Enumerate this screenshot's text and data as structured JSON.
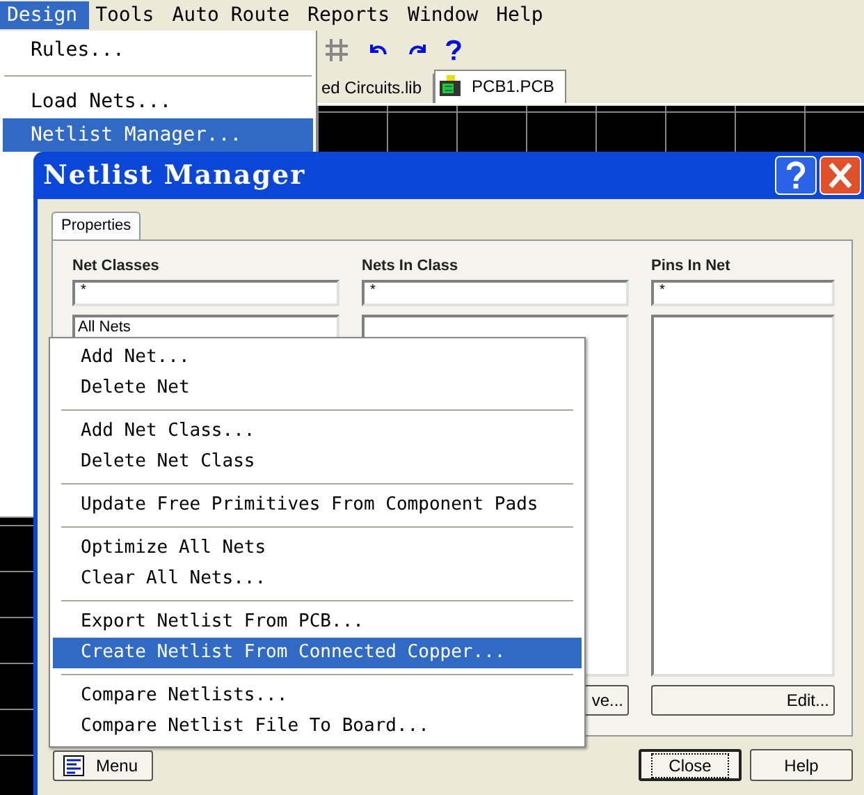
{
  "menubar": [
    {
      "label": "Design",
      "selected": true
    },
    {
      "label": "Tools",
      "selected": false
    },
    {
      "label": "Auto Route",
      "selected": false
    },
    {
      "label": "Reports",
      "selected": false
    },
    {
      "label": "Window",
      "selected": false
    },
    {
      "label": "Help",
      "selected": false
    }
  ],
  "design_menu": {
    "groups": [
      [
        {
          "label": "Rules...",
          "selected": false
        }
      ],
      [
        {
          "label": "Load Nets...",
          "selected": false
        },
        {
          "label": "Netlist Manager...",
          "selected": true
        }
      ]
    ]
  },
  "document_tabs": [
    {
      "label": "ed Circuits.lib",
      "selected": false
    },
    {
      "label": "PCB1.PCB",
      "selected": true
    }
  ],
  "dialog": {
    "title": "Netlist Manager",
    "tabs": [
      {
        "label": "Properties",
        "selected": true
      }
    ],
    "columns": [
      {
        "heading": "Net Classes",
        "filter": "*",
        "items": [
          "All Nets"
        ]
      },
      {
        "heading": "Nets In Class",
        "filter": "*",
        "button": "ve..."
      },
      {
        "heading": "Pins In Net",
        "filter": "*",
        "button": "Edit..."
      }
    ],
    "buttons": [
      {
        "label": "Menu",
        "kind": "menu",
        "focused": false
      },
      {
        "label": "Close",
        "kind": "plain",
        "focused": true
      },
      {
        "label": "Help",
        "kind": "plain",
        "focused": false
      }
    ]
  },
  "context_menu": {
    "groups": [
      [
        {
          "label": "Add Net...",
          "selected": false
        },
        {
          "label": "Delete Net",
          "selected": false
        }
      ],
      [
        {
          "label": "Add Net Class...",
          "selected": false
        },
        {
          "label": "Delete Net Class",
          "selected": false
        }
      ],
      [
        {
          "label": "Update Free Primitives From Component Pads",
          "selected": false
        }
      ],
      [
        {
          "label": "Optimize All Nets",
          "selected": false
        },
        {
          "label": "Clear All Nets...",
          "selected": false
        }
      ],
      [
        {
          "label": "Export Netlist From PCB...",
          "selected": false
        },
        {
          "label": "Create Netlist From Connected Copper...",
          "selected": true
        }
      ],
      [
        {
          "label": "Compare Netlists...",
          "selected": false
        },
        {
          "label": "Compare Netlist File To Board...",
          "selected": false
        }
      ]
    ]
  }
}
